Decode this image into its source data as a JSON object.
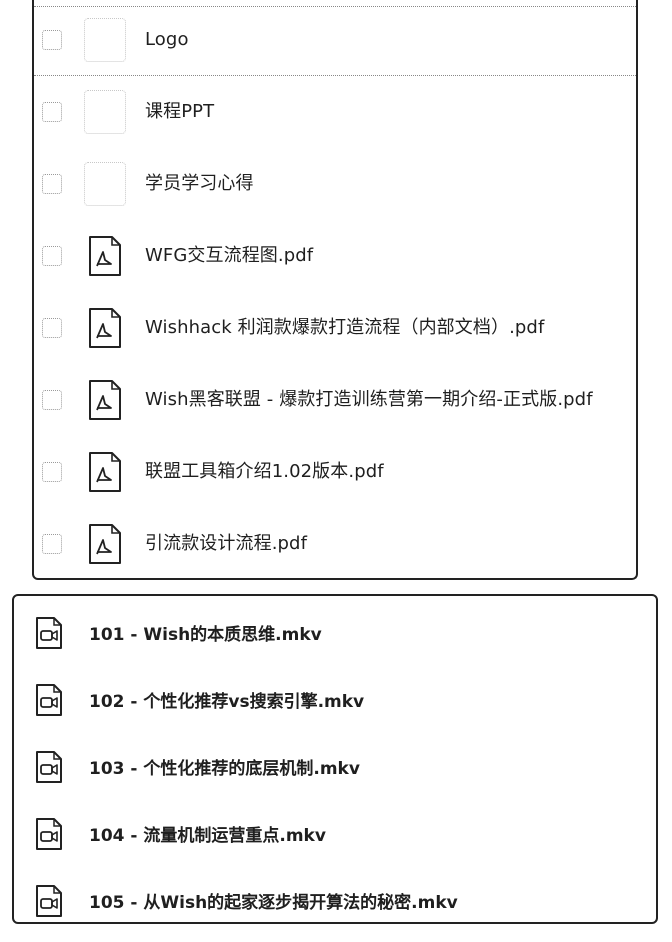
{
  "documents": {
    "items": [
      {
        "name": "Logo",
        "type": "folder"
      },
      {
        "name": "课程PPT",
        "type": "folder"
      },
      {
        "name": "学员学习心得",
        "type": "folder"
      },
      {
        "name": "WFG交互流程图.pdf",
        "type": "pdf"
      },
      {
        "name": "Wishhack 利润款爆款打造流程（内部文档）.pdf",
        "type": "pdf"
      },
      {
        "name": "Wish黑客联盟 - 爆款打造训练营第一期介绍-正式版.pdf",
        "type": "pdf"
      },
      {
        "name": "联盟工具箱介绍1.02版本.pdf",
        "type": "pdf"
      },
      {
        "name": "引流款设计流程.pdf",
        "type": "pdf"
      }
    ]
  },
  "videos": {
    "items": [
      {
        "name": "101 - Wish的本质思维.mkv"
      },
      {
        "name": "102 - 个性化推荐vs搜索引擎.mkv"
      },
      {
        "name": "103 - 个性化推荐的底层机制.mkv"
      },
      {
        "name": "104 - 流量机制运营重点.mkv"
      },
      {
        "name": "105 - 从Wish的起家逐步揭开算法的秘密.mkv"
      }
    ]
  },
  "icons": {
    "pdf": "pdf-file-icon",
    "video": "video-file-icon",
    "folder": "folder-thumbnail",
    "checkbox": "checkbox"
  }
}
